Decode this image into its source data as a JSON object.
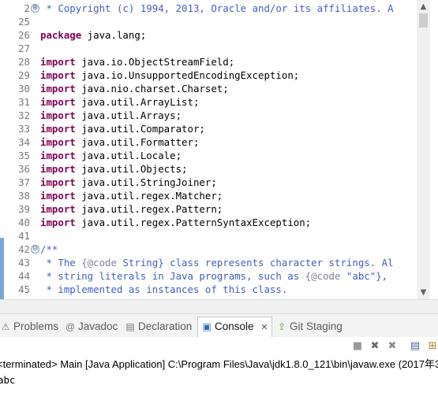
{
  "editor": {
    "lines": [
      {
        "num": "2",
        "fold": "⊕",
        "parts": [
          {
            "t": " * Copyright (c) 1994, 2013, Oracle and/or its affiliates. A",
            "c": "cm"
          }
        ]
      },
      {
        "num": "25",
        "fold": "",
        "parts": []
      },
      {
        "num": "26",
        "fold": "",
        "parts": [
          {
            "t": "package",
            "c": "kw"
          },
          {
            "t": " java.lang;",
            "c": "cls"
          }
        ]
      },
      {
        "num": "27",
        "fold": "",
        "parts": []
      },
      {
        "num": "28",
        "fold": "",
        "parts": [
          {
            "t": "import",
            "c": "kw"
          },
          {
            "t": " java.io.ObjectStreamField;",
            "c": "cls"
          }
        ]
      },
      {
        "num": "29",
        "fold": "",
        "parts": [
          {
            "t": "import",
            "c": "kw"
          },
          {
            "t": " java.io.UnsupportedEncodingException;",
            "c": "cls"
          }
        ]
      },
      {
        "num": "30",
        "fold": "",
        "parts": [
          {
            "t": "import",
            "c": "kw"
          },
          {
            "t": " java.nio.charset.Charset;",
            "c": "cls"
          }
        ]
      },
      {
        "num": "31",
        "fold": "",
        "parts": [
          {
            "t": "import",
            "c": "kw"
          },
          {
            "t": " java.util.ArrayList;",
            "c": "cls"
          }
        ]
      },
      {
        "num": "32",
        "fold": "",
        "parts": [
          {
            "t": "import",
            "c": "kw"
          },
          {
            "t": " java.util.Arrays;",
            "c": "cls"
          }
        ]
      },
      {
        "num": "33",
        "fold": "",
        "parts": [
          {
            "t": "import",
            "c": "kw"
          },
          {
            "t": " java.util.Comparator;",
            "c": "cls"
          }
        ]
      },
      {
        "num": "34",
        "fold": "",
        "parts": [
          {
            "t": "import",
            "c": "kw"
          },
          {
            "t": " java.util.Formatter;",
            "c": "cls"
          }
        ]
      },
      {
        "num": "35",
        "fold": "",
        "parts": [
          {
            "t": "import",
            "c": "kw"
          },
          {
            "t": " java.util.Locale;",
            "c": "cls"
          }
        ]
      },
      {
        "num": "36",
        "fold": "",
        "parts": [
          {
            "t": "import",
            "c": "kw"
          },
          {
            "t": " java.util.Objects;",
            "c": "cls"
          }
        ]
      },
      {
        "num": "37",
        "fold": "",
        "parts": [
          {
            "t": "import",
            "c": "kw"
          },
          {
            "t": " java.util.StringJoiner;",
            "c": "cls"
          }
        ]
      },
      {
        "num": "38",
        "fold": "",
        "parts": [
          {
            "t": "import",
            "c": "kw"
          },
          {
            "t": " java.util.regex.Matcher;",
            "c": "cls"
          }
        ]
      },
      {
        "num": "39",
        "fold": "",
        "parts": [
          {
            "t": "import",
            "c": "kw"
          },
          {
            "t": " java.util.regex.Pattern;",
            "c": "cls"
          }
        ]
      },
      {
        "num": "40",
        "fold": "",
        "parts": [
          {
            "t": "import",
            "c": "kw"
          },
          {
            "t": " java.util.regex.PatternSyntaxException;",
            "c": "cls"
          }
        ]
      },
      {
        "num": "41",
        "fold": "",
        "parts": []
      },
      {
        "num": "42",
        "fold": "⊖",
        "parts": [
          {
            "t": "/**",
            "c": "cm"
          }
        ]
      },
      {
        "num": "43",
        "fold": "",
        "parts": [
          {
            "t": " * The ",
            "c": "cm"
          },
          {
            "t": "{@code",
            "c": "tag"
          },
          {
            "t": " String} class represents character strings. Al",
            "c": "cm"
          }
        ]
      },
      {
        "num": "44",
        "fold": "",
        "parts": [
          {
            "t": " * string literals in Java programs, such as ",
            "c": "cm"
          },
          {
            "t": "{@code",
            "c": "tag"
          },
          {
            "t": " \"abc\"},",
            "c": "cm"
          }
        ]
      },
      {
        "num": "45",
        "fold": "",
        "parts": [
          {
            "t": " * implemented as instances of this class.",
            "c": "cm"
          }
        ]
      }
    ]
  },
  "views": {
    "tabs": [
      {
        "label": "Problems",
        "icon": "⚠",
        "name": "tab-problems",
        "active": false
      },
      {
        "label": "Javadoc",
        "icon": "@",
        "name": "tab-javadoc",
        "active": false
      },
      {
        "label": "Declaration",
        "icon": "▤",
        "name": "tab-declaration",
        "active": false
      },
      {
        "label": "Console",
        "icon": "▣",
        "name": "tab-console",
        "active": true
      },
      {
        "label": "Git Staging",
        "icon": "⇪",
        "name": "tab-git-staging",
        "active": false
      }
    ],
    "close_glyph": "✕"
  },
  "toolbar": {
    "buttons": [
      {
        "glyph": "■",
        "name": "terminate-icon"
      },
      {
        "glyph": "✖",
        "name": "remove-launch-icon"
      },
      {
        "glyph": "✖",
        "name": "remove-all-terminated-icon"
      },
      {
        "glyph": "▤",
        "name": "scroll-lock-icon"
      },
      {
        "glyph": "⊞",
        "name": "show-console-icon"
      }
    ]
  },
  "console": {
    "status": "<terminated> Main [Java Application] C:\\Program Files\\Java\\jdk1.8.0_121\\bin\\javaw.exe (2017年3",
    "output": "abc"
  }
}
